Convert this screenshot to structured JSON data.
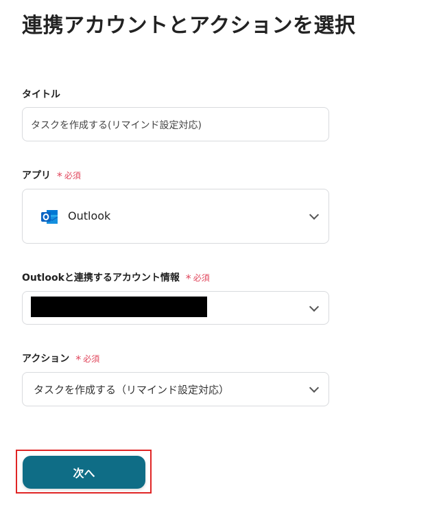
{
  "page": {
    "title": "連携アカウントとアクションを選択"
  },
  "fields": {
    "title": {
      "label": "タイトル",
      "value": "タスクを作成する(リマインド設定対応)"
    },
    "app": {
      "label": "アプリ",
      "required": "必須",
      "selected": "Outlook",
      "icon": "outlook-icon"
    },
    "account": {
      "label": "Outlookと連携するアカウント情報",
      "required": "必須",
      "value_redacted": true
    },
    "action": {
      "label": "アクション",
      "required": "必須",
      "selected": "タスクを作成する（リマインド設定対応）"
    }
  },
  "buttons": {
    "next_label": "次へ"
  },
  "colors": {
    "accent": "#0f6d86",
    "required": "#e0455b",
    "highlight": "#e02424",
    "outlook_blue": "#0a64c2"
  }
}
